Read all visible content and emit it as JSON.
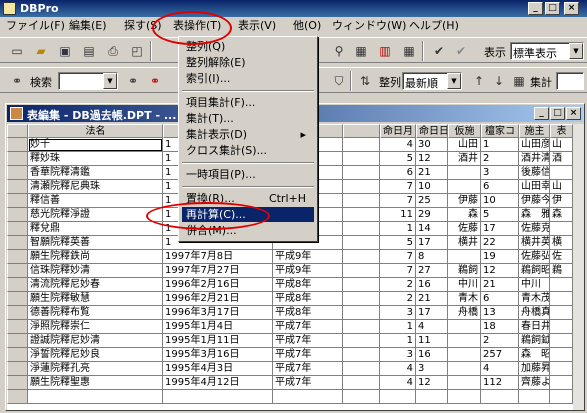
{
  "app": {
    "title": "DBPro"
  },
  "menu": [
    "ファイル(F)",
    "編集(E)",
    "探す(S)",
    "表操作(T)",
    "表示(V)",
    "他(O)",
    "ウィンドウ(W)",
    "ヘルプ(H)"
  ],
  "toolbar": {
    "view_label": "表示",
    "view_value": "標準表示",
    "search_label": "検索",
    "sort_label": "整列",
    "sort_value": "最新順",
    "aggregate_label": "集計"
  },
  "dropdown": {
    "items": [
      {
        "label": "整列(Q)",
        "shortcut": ""
      },
      {
        "label": "整列解除(E)",
        "shortcut": ""
      },
      {
        "label": "索引(I)...",
        "shortcut": ""
      },
      {
        "sep": true
      },
      {
        "label": "項目集計(F)...",
        "shortcut": ""
      },
      {
        "label": "集計(T)...",
        "shortcut": ""
      },
      {
        "label": "集計表示(D)",
        "shortcut": "▸"
      },
      {
        "label": "クロス集計(S)...",
        "shortcut": ""
      },
      {
        "sep": true
      },
      {
        "label": "一時項目(P)...",
        "shortcut": ""
      },
      {
        "sep": true
      },
      {
        "label": "置換(R)...",
        "shortcut": "Ctrl+H"
      },
      {
        "label": "再計算(C)...",
        "shortcut": "",
        "selected": true
      },
      {
        "label": "併合(M)...",
        "shortcut": ""
      }
    ]
  },
  "window": {
    "title": "表編集 - DB過去帳.DPT - ..."
  },
  "table": {
    "columns": [
      "法名",
      "",
      "",
      "",
      "命日月",
      "命日日",
      "仮施",
      "檀家コ",
      "施主",
      "表"
    ],
    "rows": [
      [
        "妙千",
        "1",
        "",
        "",
        "4",
        "30",
        "山田",
        "1",
        "山田彦市",
        "山"
      ],
      [
        "釋妙珠",
        "1",
        "",
        "",
        "5",
        "12",
        "酒井",
        "2",
        "酒井清重",
        "酒"
      ],
      [
        "香華院釋清鑑",
        "1",
        "",
        "",
        "6",
        "21",
        "",
        "3",
        "後藤信行",
        ""
      ],
      [
        "清瀬院釋尼典珠",
        "1",
        "",
        "",
        "7",
        "10",
        "",
        "6",
        "山田幸雄",
        "山"
      ],
      [
        "釋信善",
        "1",
        "",
        "",
        "7",
        "25",
        "伊藤",
        "10",
        "伊藤今生",
        "伊"
      ],
      [
        "慈光院釋淨證",
        "1",
        "",
        "",
        "11",
        "29",
        "森",
        "5",
        "森　雅昭",
        "森"
      ],
      [
        "釋兌鼎",
        "1",
        "",
        "",
        "1",
        "14",
        "佐藤",
        "17",
        "佐藤克郎",
        ""
      ],
      [
        "智願院釋英善",
        "1",
        "",
        "",
        "5",
        "17",
        "横井",
        "22",
        "横井英德",
        "横"
      ],
      [
        "願生院釋鉄尚",
        "1997年7月8日",
        "平成9年",
        "",
        "7",
        "8",
        "",
        "19",
        "佐藤弘一",
        "佐"
      ],
      [
        "信珠院釋妙清",
        "1997年7月27日",
        "平成9年",
        "",
        "7",
        "27",
        "鵜飼",
        "12",
        "鵜飼昭三",
        "鵜"
      ],
      [
        "清流院釋尼妙春",
        "1996年2月16日",
        "平成8年",
        "",
        "2",
        "16",
        "中川",
        "21",
        "中川　晃",
        ""
      ],
      [
        "願生院釋敏慧",
        "1996年2月21日",
        "平成8年",
        "",
        "2",
        "21",
        "青木",
        "6",
        "青木茂樹",
        ""
      ],
      [
        "德善院釋布覧",
        "1996年3月17日",
        "平成8年",
        "",
        "3",
        "17",
        "舟橋",
        "13",
        "舟橋真紀",
        ""
      ],
      [
        "淨照院釋崇仁",
        "1995年1月4日",
        "平成7年",
        "",
        "1",
        "4",
        "",
        "18",
        "春日井哲夫",
        ""
      ],
      [
        "證誠院釋尼妙清",
        "1995年1月11日",
        "平成7年",
        "",
        "1",
        "11",
        "",
        "2",
        "鵜飼鉞雄",
        ""
      ],
      [
        "淨誓院釋尼妙良",
        "1995年3月16日",
        "平成7年",
        "",
        "3",
        "16",
        "",
        "257",
        "森　昭一",
        ""
      ],
      [
        "淨蓮院釋孔亮",
        "1995年4月3日",
        "平成7年",
        "",
        "4",
        "3",
        "",
        "4",
        "加藤昇三",
        ""
      ],
      [
        "願生院釋聖惠",
        "1995年4月12日",
        "平成7年",
        "",
        "4",
        "12",
        "",
        "112",
        "齊藤よし子",
        ""
      ],
      [
        "",
        "",
        "",
        "",
        "",
        "",
        "",
        "",
        "",
        ""
      ]
    ]
  },
  "colors": {
    "highlight": "#0a246a",
    "annotation": "#e00000",
    "chrome": "#d4d0c8"
  },
  "icons": [
    "app-icon",
    "new-icon",
    "open-icon",
    "save-icon",
    "print-icon",
    "search-icon",
    "sort-icon",
    "aggregate-icon",
    "close-icon",
    "minimize-icon",
    "maximize-icon"
  ]
}
